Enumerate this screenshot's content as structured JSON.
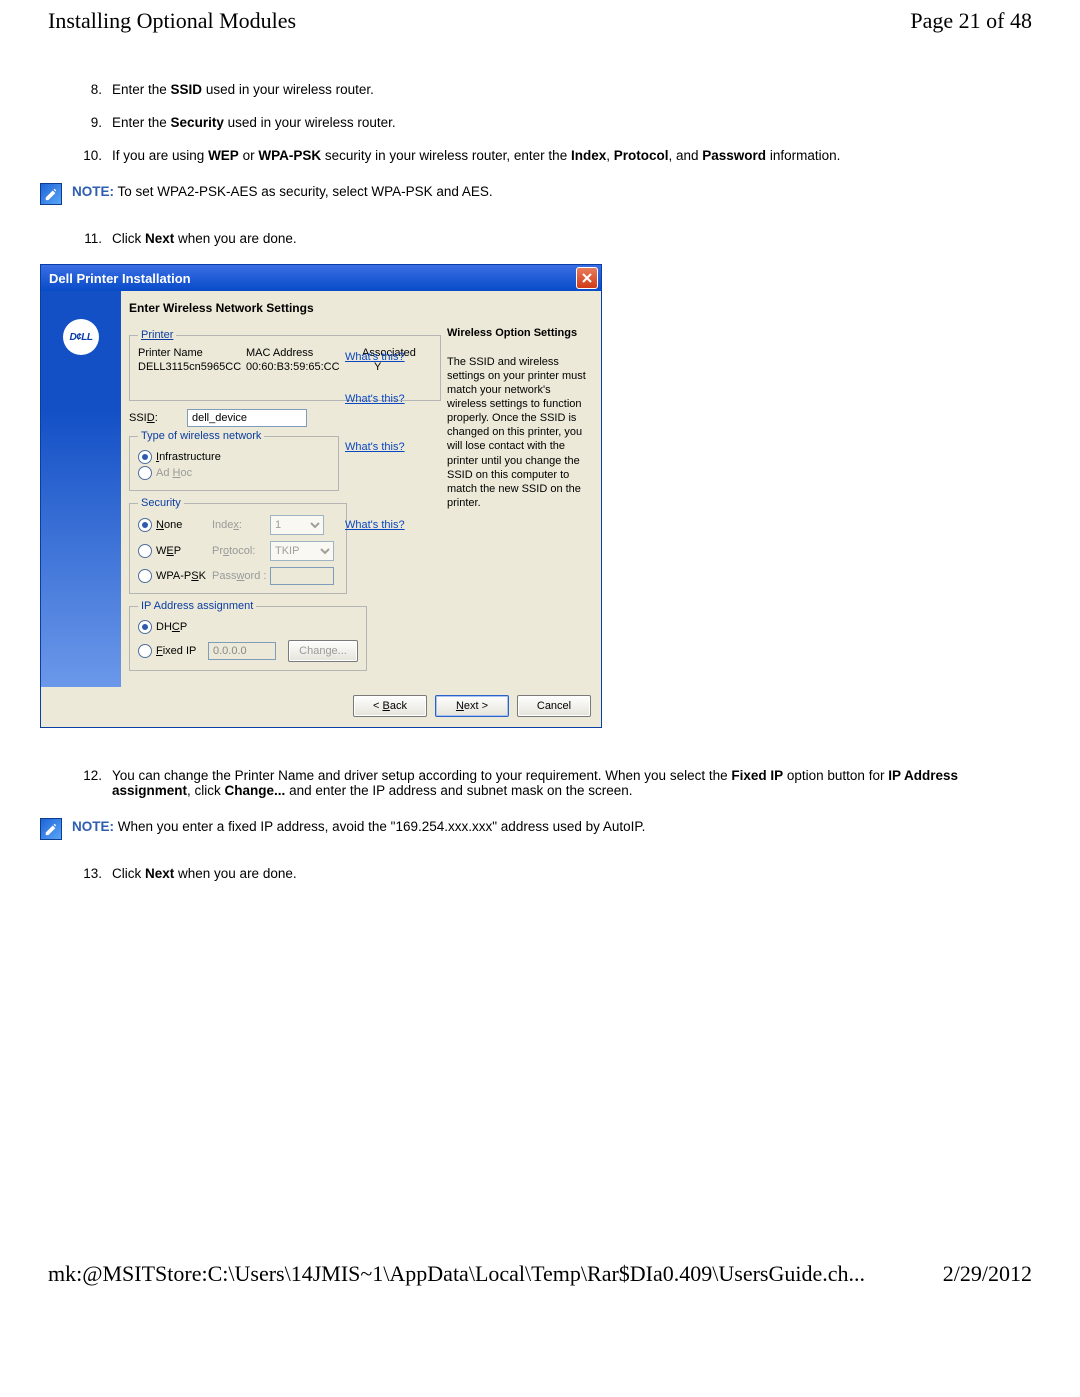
{
  "header": {
    "title": "Installing Optional Modules",
    "pageinfo": "Page 21 of 48"
  },
  "steps_a": [
    {
      "n": "8.",
      "html": [
        "Enter the ",
        "SSID",
        " used in your wireless router."
      ]
    },
    {
      "n": "9.",
      "html": [
        "Enter the ",
        "Security",
        " used in your wireless router."
      ]
    },
    {
      "n": "10.",
      "html": [
        "If you are using ",
        "WEP",
        " or ",
        "WPA-PSK",
        " security in your wireless router, enter the ",
        "Index",
        ", ",
        "Protocol",
        ", and ",
        "Password",
        " information."
      ]
    }
  ],
  "note1": {
    "label": "NOTE:",
    "text": " To set WPA2-PSK-AES as security, select WPA-PSK and AES."
  },
  "step11": {
    "n": "11.",
    "html": [
      "Click ",
      "Next",
      " when you are done."
    ]
  },
  "dialog": {
    "title": "Dell Printer Installation",
    "heading": "Enter Wireless Network Settings",
    "printer_legend": "Printer",
    "printer_cols": {
      "name_h": "Printer Name",
      "mac_h": "MAC Address",
      "assoc_h": "Associated",
      "name_v": "DELL3115cn5965CC",
      "mac_v": "00:60:B3:59:65:CC",
      "assoc_v": "Y"
    },
    "ssid_label": "SSID:",
    "ssid_value": "dell_device",
    "whats_this": "What's this?",
    "type_legend": "Type of wireless network",
    "type_infra": "Infrastructure",
    "type_adhoc": "Ad Hoc",
    "security_legend": "Security",
    "sec_none": "None",
    "sec_wep": "WEP",
    "sec_wpa": "WPA-PSK",
    "sec_index": "Index:",
    "sec_proto": "Protocol:",
    "sec_pass": "Password :",
    "sec_index_val": "1",
    "sec_proto_val": "TKIP",
    "ip_legend": "IP Address assignment",
    "ip_dhcp": "DHCP",
    "ip_fixed": "Fixed IP",
    "ip_value": "0.0.0.0",
    "change_btn": "Change...",
    "right_title": "Wireless Option Settings",
    "right_body": "The SSID and wireless settings on your printer must match your network's wireless settings to function properly. Once the SSID is changed on this printer, you will lose contact with the printer until you change the SSID on this computer to match the new SSID on the printer.",
    "back": "< Back",
    "next": "Next >",
    "cancel": "Cancel",
    "logo": "D¢LL"
  },
  "step12": {
    "n": "12.",
    "text_a": "You can change the Printer Name and driver setup according to your requirement. When you select the ",
    "b1": "Fixed IP",
    "text_b": " option button for ",
    "b2": "IP Address assignment",
    "text_c": ", click ",
    "b3": "Change...",
    "text_d": " and enter the IP address and subnet mask on the screen."
  },
  "note2": {
    "label": "NOTE:",
    "text": " When you enter a fixed IP address, avoid the \"169.254.xxx.xxx\" address used by AutoIP."
  },
  "step13": {
    "n": "13.",
    "html": [
      "Click ",
      "Next",
      " when you are done."
    ]
  },
  "footer": {
    "path": "mk:@MSITStore:C:\\Users\\14JMIS~1\\AppData\\Local\\Temp\\Rar$DIa0.409\\UsersGuide.ch...",
    "date": "2/29/2012"
  }
}
